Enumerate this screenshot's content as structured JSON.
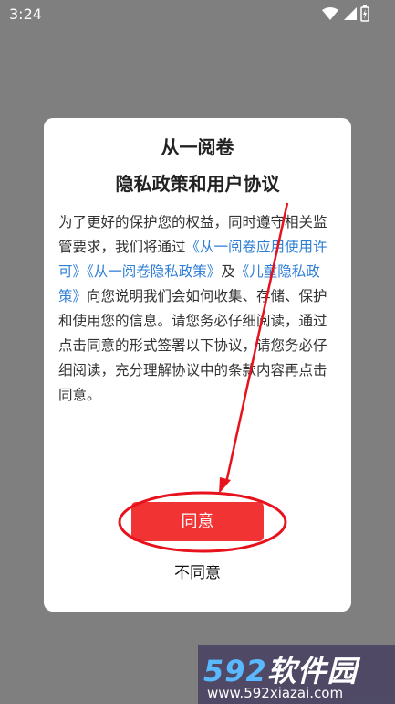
{
  "status_bar": {
    "time": "3:24"
  },
  "dialog": {
    "title_line1": "从一阅卷",
    "title_line2": "隐私政策和用户协议",
    "body": {
      "p1": "为了更好的保护您的权益，同时遵守相关监管要求，我们将通过",
      "link1": "《从一阅卷应用使用许可》",
      "link2": "《从一阅卷隐私政策》",
      "and": "及",
      "link3": "《儿童隐私政策》",
      "p2": "向您说明我们会如何收集、存储、保护和使用您的信息。请您务必仔细阅读，通过点击同意的形式签署以下协议，请您务必仔细阅读，充分理解协议中的条款内容再点击同意。"
    },
    "agree_label": "同意",
    "disagree_label": "不同意"
  },
  "watermark": {
    "logo_num": "592",
    "logo_text": "软件园",
    "url": "www.592xiazai.com"
  },
  "colors": {
    "accent_red": "#f23333",
    "link_blue": "#2f7fd6",
    "backdrop": "#7f7f7f"
  }
}
